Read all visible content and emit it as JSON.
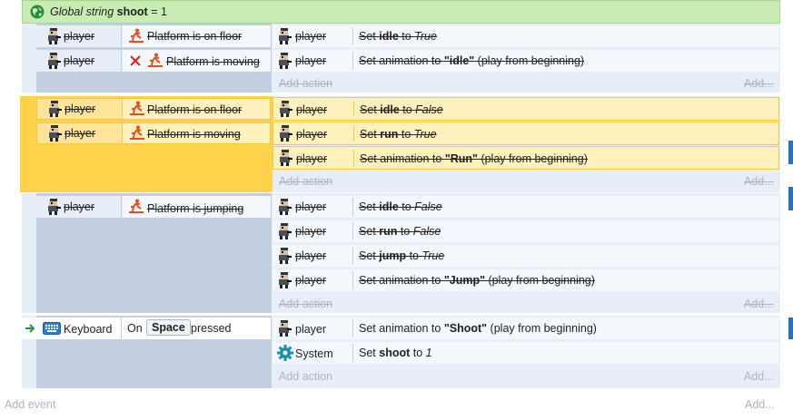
{
  "global_var": {
    "prefix": "Global string",
    "name": "shoot",
    "op": "=",
    "value": "1",
    "icon": "globe-icon"
  },
  "events": [
    {
      "conditions": [
        {
          "object": "player",
          "icon": "platform-icon",
          "text": "Platform is on floor",
          "inverted": false
        },
        {
          "object": "player",
          "icon": "platform-icon",
          "text": "Platform is moving",
          "inverted": true
        }
      ],
      "actions": [
        {
          "object": "player",
          "pre": "Set ",
          "bold": "idle",
          "mid": " to ",
          "italic": "True",
          "post": ""
        },
        {
          "object": "player",
          "pre": "Set animation to ",
          "bold": "\"idle\"",
          "mid": "",
          "italic": "",
          "post": " (play from beginning)"
        }
      ],
      "add_action": "Add action",
      "add_more": "Add..."
    },
    {
      "conditions": [
        {
          "object": "player",
          "icon": "platform-icon",
          "text": "Platform is on floor",
          "inverted": false
        },
        {
          "object": "player",
          "icon": "platform-icon",
          "text": "Platform is moving",
          "inverted": false
        }
      ],
      "actions": [
        {
          "object": "player",
          "pre": "Set ",
          "bold": "idle",
          "mid": " to ",
          "italic": "False",
          "post": ""
        },
        {
          "object": "player",
          "pre": "Set ",
          "bold": "run",
          "mid": " to ",
          "italic": "True",
          "post": ""
        },
        {
          "object": "player",
          "pre": "Set animation to ",
          "bold": "\"Run\"",
          "mid": "",
          "italic": "",
          "post": " (play from beginning)"
        }
      ],
      "add_action": "Add action",
      "add_more": "Add..."
    },
    {
      "conditions": [
        {
          "object": "player",
          "icon": "platform-icon",
          "text": "Platform is jumping",
          "inverted": false
        }
      ],
      "actions": [
        {
          "object": "player",
          "pre": "Set ",
          "bold": "idle",
          "mid": " to ",
          "italic": "False",
          "post": ""
        },
        {
          "object": "player",
          "pre": "Set ",
          "bold": "run",
          "mid": " to ",
          "italic": "False",
          "post": ""
        },
        {
          "object": "player",
          "pre": "Set ",
          "bold": "jump",
          "mid": " to ",
          "italic": "True",
          "post": ""
        },
        {
          "object": "player",
          "pre": "Set animation to ",
          "bold": "\"Jump\"",
          "mid": "",
          "italic": "",
          "post": " (play from beginning)"
        }
      ],
      "add_action": "Add action",
      "add_more": "Add..."
    },
    {
      "conditions": [
        {
          "object": "Keyboard",
          "on": "On",
          "key": "Space",
          "pressed": "pressed"
        }
      ],
      "actions": [
        {
          "object": "player",
          "pre": "Set animation to ",
          "bold": "\"Shoot\"",
          "mid": "",
          "italic": "",
          "post": " (play from beginning)"
        },
        {
          "object": "System",
          "pre": "Set ",
          "bold": "shoot",
          "mid": " to ",
          "italic": "1",
          "post": ""
        }
      ],
      "add_action": "Add action",
      "add_more": "Add..."
    }
  ],
  "footer": {
    "add_event": "Add event",
    "add_more": "Add..."
  },
  "colors": {
    "global_bg": "#c9ecb4",
    "event_bg": "#e8eef8",
    "event_margin": "#c3cfe0",
    "selected_bg": "#fff1bd",
    "selected_margin": "#ffd24a",
    "accent_strip": "#2f6fb3"
  }
}
